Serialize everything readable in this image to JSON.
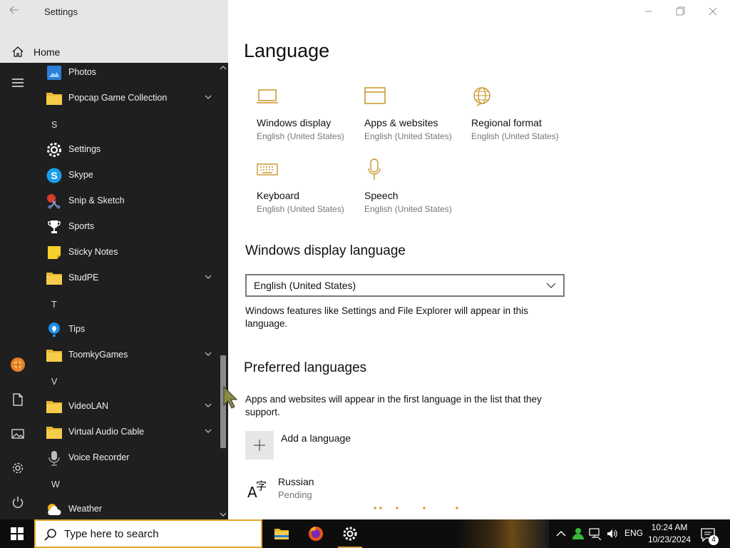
{
  "window": {
    "title": "Settings",
    "home_label": "Home"
  },
  "start_menu": {
    "apps": [
      {
        "label": "Photos",
        "icon": "photos-icon"
      },
      {
        "label": "Popcap Game Collection",
        "icon": "folder-icon",
        "expandable": true
      },
      {
        "label": "Settings",
        "icon": "gear-icon"
      },
      {
        "label": "Skype",
        "icon": "skype-icon"
      },
      {
        "label": "Snip & Sketch",
        "icon": "snip-sketch-icon"
      },
      {
        "label": "Sports",
        "icon": "trophy-icon"
      },
      {
        "label": "Sticky Notes",
        "icon": "sticky-notes-icon"
      },
      {
        "label": "StudPE",
        "icon": "folder-icon",
        "expandable": true
      },
      {
        "label": "Tips",
        "icon": "lightbulb-icon"
      },
      {
        "label": "ToomkyGames",
        "icon": "folder-icon",
        "expandable": true
      },
      {
        "label": "VideoLAN",
        "icon": "folder-icon",
        "expandable": true
      },
      {
        "label": "Virtual Audio Cable",
        "icon": "folder-icon",
        "expandable": true
      },
      {
        "label": "Voice Recorder",
        "icon": "microphone-icon"
      },
      {
        "label": "Weather",
        "icon": "weather-icon"
      }
    ],
    "letters": [
      "S",
      "T",
      "V",
      "W"
    ]
  },
  "main": {
    "page_title": "Language",
    "tiles": [
      {
        "title": "Windows display",
        "subtitle": "English (United States)",
        "icon": "laptop-icon"
      },
      {
        "title": "Apps & websites",
        "subtitle": "English (United States)",
        "icon": "browser-window-icon"
      },
      {
        "title": "Regional format",
        "subtitle": "English (United States)",
        "icon": "globe-icon"
      },
      {
        "title": "Keyboard",
        "subtitle": "English (United States)",
        "icon": "keyboard-icon"
      },
      {
        "title": "Speech",
        "subtitle": "English (United States)",
        "icon": "microphone-icon"
      }
    ],
    "display_language": {
      "heading": "Windows display language",
      "selected": "English (United States)",
      "description": "Windows features like Settings and File Explorer will appear in this language."
    },
    "preferred": {
      "heading": "Preferred languages",
      "description": "Apps and websites will appear in the first language in the list that they support.",
      "add_label": "Add a language",
      "languages": [
        {
          "name": "Russian",
          "status": "Pending"
        }
      ]
    }
  },
  "taskbar": {
    "search_placeholder": "Type here to search",
    "language": "ENG",
    "time": "10:24 AM",
    "date": "10/23/2024",
    "notification_count": "4"
  },
  "colors": {
    "accent": "#d8a040",
    "start_bg": "#1f1f1f",
    "taskbar_bg": "#0d0d0d"
  }
}
